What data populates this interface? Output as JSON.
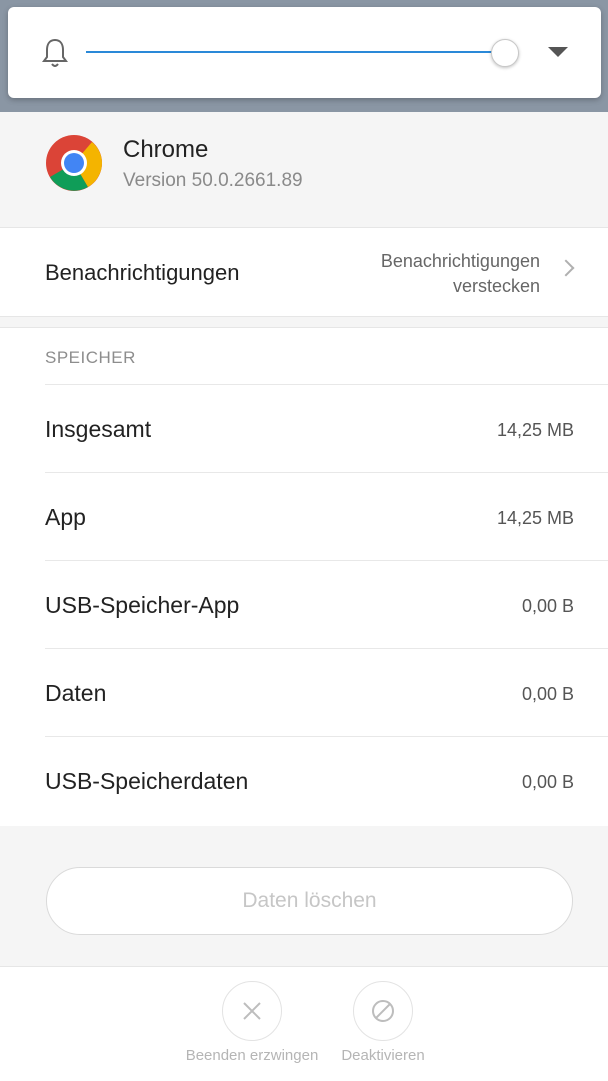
{
  "volume_panel": {
    "level": 1.0,
    "icons": [
      "bell-icon",
      "chevron-down-icon"
    ],
    "accent_color": "#2a89d8"
  },
  "app": {
    "name": "Chrome",
    "version": "Version 50.0.2661.89",
    "icon": "chrome-logo"
  },
  "notifications": {
    "label": "Benachrichtigungen",
    "value_line1": "Benachrichtigungen",
    "value_line2": "verstecken"
  },
  "storage": {
    "title": "SPEICHER",
    "rows": [
      {
        "label": "Insgesamt",
        "value": "14,25 MB"
      },
      {
        "label": "App",
        "value": "14,25 MB"
      },
      {
        "label": "USB-Speicher-App",
        "value": "0,00 B"
      },
      {
        "label": "Daten",
        "value": "0,00 B"
      },
      {
        "label": "USB-Speicherdaten",
        "value": "0,00 B"
      }
    ]
  },
  "clear_data_button": "Daten löschen",
  "actions": [
    {
      "label": "Beenden erzwingen",
      "icon": "close-icon"
    },
    {
      "label": "Deaktivieren",
      "icon": "disable-icon"
    }
  ]
}
